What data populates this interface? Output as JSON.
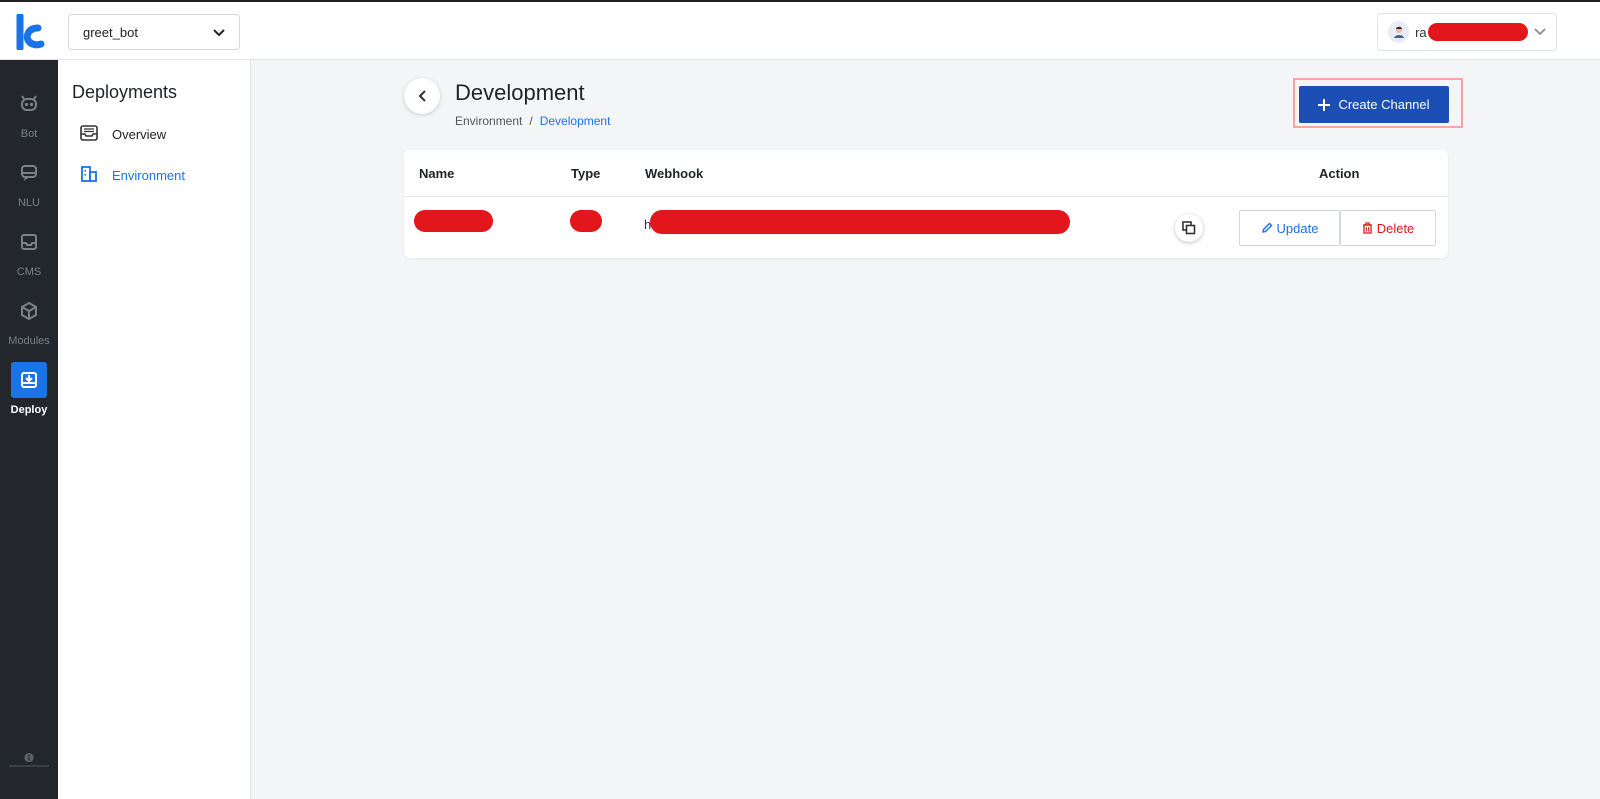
{
  "topbar": {
    "bot_selector": {
      "value": "greet_bot"
    },
    "user": {
      "name_visible": "ra"
    }
  },
  "rail": {
    "items": [
      {
        "label": "Bot",
        "icon": "bot-icon"
      },
      {
        "label": "NLU",
        "icon": "chat-icon"
      },
      {
        "label": "CMS",
        "icon": "inbox-icon"
      },
      {
        "label": "Modules",
        "icon": "cube-icon"
      },
      {
        "label": "Deploy",
        "icon": "deploy-icon",
        "active": true
      }
    ],
    "help_icon": "help-icon"
  },
  "sidebar": {
    "title": "Deployments",
    "items": [
      {
        "label": "Overview",
        "icon": "inbox-icon"
      },
      {
        "label": "Environment",
        "icon": "building-icon",
        "active": true
      }
    ]
  },
  "main": {
    "title": "Development",
    "breadcrumb": {
      "parent": "Environment",
      "separator": "/",
      "current": "Development"
    },
    "create_button": {
      "label": "Create Channel"
    }
  },
  "table": {
    "columns": [
      "Name",
      "Type",
      "Webhook",
      "Action"
    ],
    "rows": [
      {
        "name": "[redacted]",
        "type": "[redacted]",
        "webhook_prefix": "h",
        "actions": {
          "update": "Update",
          "delete": "Delete"
        }
      }
    ]
  },
  "colors": {
    "accent": "#1a73e8",
    "primary_button": "#1b4fb6",
    "danger": "#e3161c",
    "rail_bg": "#23272b",
    "redaction": "#e3161c"
  }
}
